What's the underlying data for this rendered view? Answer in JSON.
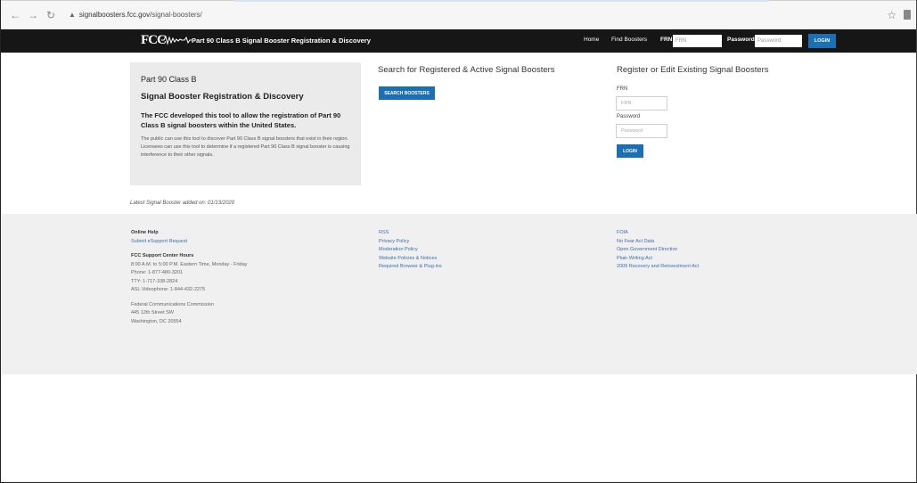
{
  "browser": {
    "url_host": "signalboosters.fcc.gov",
    "url_path": "/signal-boosters/"
  },
  "header": {
    "logo": "FCC",
    "site_title": "Part 90 Class B Signal Booster Registration & Discovery",
    "nav": {
      "home": "Home",
      "find": "Find Boosters"
    },
    "frn_label": "FRN",
    "frn_placeholder": "FRN",
    "password_label": "Password",
    "password_placeholder": "Password",
    "login": "LOGIN"
  },
  "intro": {
    "line1": "Part 90 Class B",
    "line2": "Signal Booster Registration & Discovery",
    "lead": "The FCC developed this tool to allow the registration of Part 90 Class B signal boosters within the United States.",
    "body": "The public can use this tool to discover Part 90 Class B signal boosters that exist in their region. Licensees can use this tool to determine if a registered Part 90 Class B signal booster is causing interference to their other signals."
  },
  "search": {
    "title": "Search for Registered & Active Signal Boosters",
    "button": "SEARCH BOOSTERS"
  },
  "register": {
    "title": "Register or Edit Existing Signal Boosters",
    "frn_label": "FRN",
    "frn_placeholder": "FRN",
    "password_label": "Password",
    "password_placeholder": "Password",
    "login": "LOGIN"
  },
  "latest": "Latest Signal Booster added on: 01/13/2020",
  "footer": {
    "col1": {
      "online_help": "Online Help",
      "esupport": "Submit eSupport Request",
      "hours_title": "FCC Support Center Hours",
      "hours": "8:00 A.M. to 5:00 P.M. Eastern Time, Monday - Friday",
      "phone": "Phone: 1-877-480-3201",
      "tty": "TTY: 1-717-338-2824",
      "asl": "ASL Videophone: 1-844-432-2275",
      "org": "Federal Communications Commission",
      "street": "445 12th Street SW",
      "city": "Washington, DC 20554"
    },
    "col2": [
      "RSS",
      "Privacy Policy",
      "Moderation Policy",
      "Website Policies & Notices",
      "Required Browser & Plug-ins"
    ],
    "col3": [
      "FOIA",
      "No Fear Act Data",
      "Open Government Directive",
      "Plain Writing Act",
      "2009 Recovery and Reinvestment Act"
    ]
  }
}
